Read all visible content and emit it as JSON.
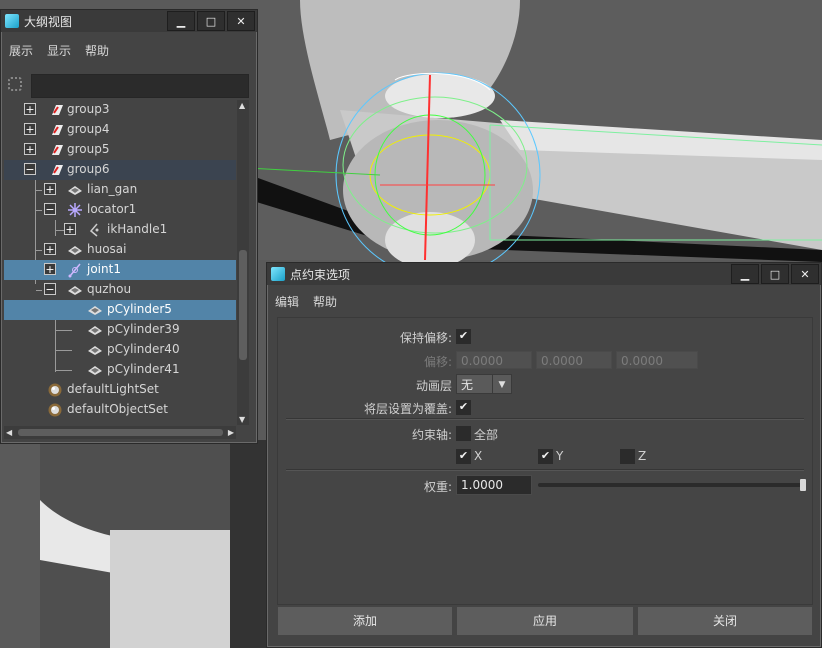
{
  "outliner": {
    "title": "大纲视图",
    "window_buttons": [
      "▁",
      "□",
      "✕"
    ],
    "menu": [
      "展示",
      "显示",
      "帮助"
    ],
    "filter_placeholder": "",
    "items": [
      {
        "label": "group3",
        "icon": "group-icon",
        "expander": "+"
      },
      {
        "label": "group4",
        "icon": "group-icon",
        "expander": "+"
      },
      {
        "label": "group5",
        "icon": "group-icon",
        "expander": "+"
      },
      {
        "label": "group6",
        "icon": "group-icon",
        "expander": "−"
      },
      {
        "label": "lian_gan",
        "icon": "mesh-icon",
        "expander": "+"
      },
      {
        "label": "locator1",
        "icon": "locator-icon",
        "expander": "−"
      },
      {
        "label": "ikHandle1",
        "icon": "ikhandle-icon",
        "expander": "+"
      },
      {
        "label": "huosai",
        "icon": "mesh-icon",
        "expander": "+"
      },
      {
        "label": "joint1",
        "icon": "joint-icon",
        "expander": "+"
      },
      {
        "label": "quzhou",
        "icon": "mesh-icon",
        "expander": "−"
      },
      {
        "label": "pCylinder5",
        "icon": "mesh-icon"
      },
      {
        "label": "pCylinder39",
        "icon": "mesh-icon"
      },
      {
        "label": "pCylinder40",
        "icon": "mesh-icon"
      },
      {
        "label": "pCylinder41",
        "icon": "mesh-icon"
      },
      {
        "label": "defaultLightSet",
        "icon": "set-icon"
      },
      {
        "label": "defaultObjectSet",
        "icon": "set-icon"
      }
    ],
    "selected": [
      "joint1",
      "pCylinder5"
    ]
  },
  "dialog": {
    "title": "点约束选项",
    "window_buttons": [
      "▁",
      "□",
      "✕"
    ],
    "menu": [
      "编辑",
      "帮助"
    ],
    "maintain_offset_label": "保持偏移:",
    "maintain_offset_checked": true,
    "offset_label": "偏移:",
    "offset_values": [
      "0.0000",
      "0.0000",
      "0.0000"
    ],
    "anim_layer_label": "动画层",
    "anim_layer_value": "无",
    "set_layer_override_label": "将层设置为覆盖:",
    "set_layer_override_checked": true,
    "constraint_axes_label": "约束轴:",
    "all_label": "全部",
    "all_checked": false,
    "axis_x_label": "X",
    "axis_y_label": "Y",
    "axis_z_label": "Z",
    "axis_x_checked": true,
    "axis_y_checked": true,
    "axis_z_checked": false,
    "weight_label": "权重:",
    "weight_value": "1.0000",
    "weight_fraction": 1.0,
    "buttons": {
      "add": "添加",
      "apply": "应用",
      "close": "关闭"
    }
  },
  "colors": {
    "selection": "#5284a8",
    "panel": "#444444",
    "viewport": "#5a5a5a"
  }
}
